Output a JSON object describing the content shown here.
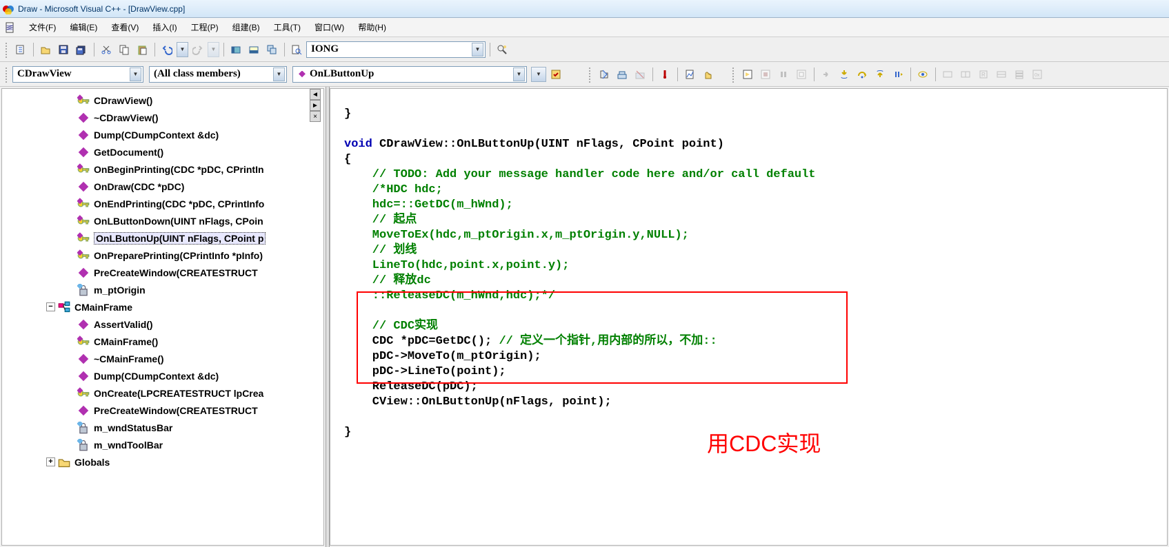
{
  "title": "Draw - Microsoft Visual C++ - [DrawView.cpp]",
  "menu": {
    "file": "文件(F)",
    "edit": "编辑(E)",
    "view": "查看(V)",
    "insert": "插入(I)",
    "project": "工程(P)",
    "build": "组建(B)",
    "tools": "工具(T)",
    "window": "窗口(W)",
    "help": "帮助(H)"
  },
  "toolbar1": {
    "searchbox": "IONG"
  },
  "toolbar2": {
    "class_combo": "CDrawView",
    "filter_combo": "(All class members)",
    "member_combo": "OnLButtonUp"
  },
  "tree": [
    {
      "indent": 3,
      "icon": "key",
      "label": "CDrawView()"
    },
    {
      "indent": 3,
      "icon": "diamond",
      "label": "~CDrawView()"
    },
    {
      "indent": 3,
      "icon": "diamond",
      "label": "Dump(CDumpContext &dc)"
    },
    {
      "indent": 3,
      "icon": "diamond",
      "label": "GetDocument()"
    },
    {
      "indent": 3,
      "icon": "key",
      "label": "OnBeginPrinting(CDC *pDC, CPrintIn"
    },
    {
      "indent": 3,
      "icon": "diamond",
      "label": "OnDraw(CDC *pDC)"
    },
    {
      "indent": 3,
      "icon": "key",
      "label": "OnEndPrinting(CDC *pDC, CPrintInfo"
    },
    {
      "indent": 3,
      "icon": "key",
      "label": "OnLButtonDown(UINT nFlags, CPoin"
    },
    {
      "indent": 3,
      "icon": "key",
      "label": "OnLButtonUp(UINT nFlags, CPoint p",
      "selected": true
    },
    {
      "indent": 3,
      "icon": "key",
      "label": "OnPreparePrinting(CPrintInfo *pInfo)"
    },
    {
      "indent": 3,
      "icon": "diamond",
      "label": "PreCreateWindow(CREATESTRUCT"
    },
    {
      "indent": 3,
      "icon": "lock",
      "label": "m_ptOrigin"
    },
    {
      "indent": 2,
      "icon": "class",
      "label": "CMainFrame",
      "exp": "-"
    },
    {
      "indent": 3,
      "icon": "diamond",
      "label": "AssertValid()"
    },
    {
      "indent": 3,
      "icon": "key",
      "label": "CMainFrame()"
    },
    {
      "indent": 3,
      "icon": "diamond",
      "label": "~CMainFrame()"
    },
    {
      "indent": 3,
      "icon": "diamond",
      "label": "Dump(CDumpContext &dc)"
    },
    {
      "indent": 3,
      "icon": "key",
      "label": "OnCreate(LPCREATESTRUCT lpCrea"
    },
    {
      "indent": 3,
      "icon": "diamond",
      "label": "PreCreateWindow(CREATESTRUCT"
    },
    {
      "indent": 3,
      "icon": "lock",
      "label": "m_wndStatusBar"
    },
    {
      "indent": 3,
      "icon": "lock",
      "label": "m_wndToolBar"
    },
    {
      "indent": 2,
      "icon": "folder",
      "label": "Globals",
      "exp": "+"
    }
  ],
  "code": {
    "l1": "}",
    "l2": "",
    "l3a": "void",
    "l3b": " CDrawView::OnLButtonUp(UINT nFlags, CPoint point)",
    "l4": "{",
    "l5": "    // TODO: Add your message handler code here and/or call default",
    "l6": "    /*HDC hdc;",
    "l7": "    hdc=::GetDC(m_hWnd);",
    "l8": "    // 起点",
    "l9": "    MoveToEx(hdc,m_ptOrigin.x,m_ptOrigin.y,NULL);",
    "l10": "    // 划线",
    "l11": "    LineTo(hdc,point.x,point.y);",
    "l12": "    // 释放dc",
    "l13": "    ::ReleaseDC(m_hWnd,hdc);*/",
    "l14": "",
    "l15": "    // CDC实现",
    "l16a": "    CDC *pDC=GetDC(); ",
    "l16b": "// 定义一个指针,用内部的所以，不加::",
    "l17": "    pDC->MoveTo(m_ptOrigin);",
    "l18": "    pDC->LineTo(point);",
    "l19": "    ReleaseDC(pDC);",
    "l20": "    CView::OnLButtonUp(nFlags, point);",
    "l21": "",
    "l22": "}"
  },
  "annotation": "用CDC实现"
}
